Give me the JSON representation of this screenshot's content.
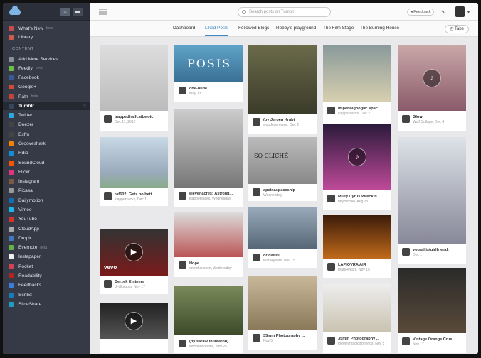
{
  "sidebar": {
    "top_buttons": [
      "home-icon",
      "film-icon"
    ],
    "pinned": [
      {
        "label": "What's New",
        "beta": "beta",
        "color": "#c94c4c"
      },
      {
        "label": "Library",
        "beta": "",
        "color": "#d15a4a"
      }
    ],
    "section_label": "CONTENT",
    "items": [
      {
        "label": "Add More Services",
        "beta": "",
        "color": "#8a8f99"
      },
      {
        "label": "Feedly",
        "beta": "beta",
        "color": "#6cc04a"
      },
      {
        "label": "Facebook",
        "beta": "",
        "color": "#3b5998"
      },
      {
        "label": "Google+",
        "beta": "",
        "color": "#d34836"
      },
      {
        "label": "Path",
        "beta": "beta",
        "color": "#c2453a"
      },
      {
        "label": "Tumblr",
        "beta": "",
        "color": "#35465c",
        "selected": true
      },
      {
        "label": "Twitter",
        "beta": "",
        "color": "#29a9e1"
      },
      {
        "label": "Deezer",
        "beta": "",
        "color": "#444"
      },
      {
        "label": "Exfm",
        "beta": "",
        "color": "#444"
      },
      {
        "label": "Grooveshark",
        "beta": "",
        "color": "#f77f00"
      },
      {
        "label": "Rdio",
        "beta": "",
        "color": "#0f8fd7"
      },
      {
        "label": "SoundCloud",
        "beta": "",
        "color": "#ff5500"
      },
      {
        "label": "Flickr",
        "beta": "",
        "color": "#e2337d"
      },
      {
        "label": "Instagram",
        "beta": "",
        "color": "#7a5a44"
      },
      {
        "label": "Picasa",
        "beta": "",
        "color": "#999"
      },
      {
        "label": "Dailymotion",
        "beta": "",
        "color": "#0e6fb5"
      },
      {
        "label": "Vimeo",
        "beta": "",
        "color": "#1ab7ea"
      },
      {
        "label": "YouTube",
        "beta": "",
        "color": "#d9322c"
      },
      {
        "label": "CloudApp",
        "beta": "",
        "color": "#aaa"
      },
      {
        "label": "Droplr",
        "beta": "",
        "color": "#3e78c1"
      },
      {
        "label": "Evernote",
        "beta": "beta",
        "color": "#61b248"
      },
      {
        "label": "Instapaper",
        "beta": "",
        "color": "#eee"
      },
      {
        "label": "Pocket",
        "beta": "",
        "color": "#d54055"
      },
      {
        "label": "Readability",
        "beta": "",
        "color": "#b3231f"
      },
      {
        "label": "Feedbacks",
        "beta": "",
        "color": "#3b7dd8"
      },
      {
        "label": "Scribd",
        "beta": "",
        "color": "#1a7bba"
      },
      {
        "label": "SlideShare",
        "beta": "",
        "color": "#1c9ec4"
      }
    ]
  },
  "topbar": {
    "search_placeholder": "Search posts on Tumblr",
    "feedback_label": "Feedback"
  },
  "tabs": [
    "Dashboard",
    "Liked Posts",
    "Followed Blogs",
    "Robby's playground",
    "The Film Stage",
    "The Burning House"
  ],
  "active_tab": 1,
  "tabs_button": "Tabs",
  "posts": [
    {
      "title": "trappedhalfcatbwoic",
      "sub": "Dec 11, 2012",
      "bg": "linear-gradient(#ddd,#bbb)"
    },
    {
      "title": "raf602: Gets no bett...",
      "sub": "klappersacks, Dec 1",
      "bg": "linear-gradient(#c9d8e5,#9ab 70%,#8a8)"
    },
    {
      "title": "Berzek Eminem",
      "sub": "dj-tillomoto, Nov 17",
      "bg": "linear-gradient(#333,#7a1a1a)"
    },
    {
      "title": "",
      "sub": "",
      "bg": "linear-gradient(#222,#555)"
    },
    {
      "title": "one-nude",
      "sub": "May 13",
      "bg": "linear-gradient(#5fa3c8,#3a6f94)"
    },
    {
      "title": "elevenacres: Astrojet...",
      "sub": "klappersacks, Wednesday",
      "bg": "linear-gradient(#ccc,#777)"
    },
    {
      "title": "Hope",
      "sub": "onnickarlsson, Wednesday",
      "bg": "linear-gradient(#ddd,#b55)"
    },
    {
      "title": "(by sarawuh Intarob)",
      "sub": "woodendreams, Nov 25",
      "bg": "linear-gradient(#7a8a5a,#3c4a2a)"
    },
    {
      "title": "(by Jeroen Krabi",
      "sub": "woodendreams, Dec 2",
      "bg": "linear-gradient(#6a6a4a,#3b3b2a)"
    },
    {
      "title": "apeinaspaceship",
      "sub": "Wednesday",
      "bg": "linear-gradient(#bbb,#888)"
    },
    {
      "title": "orlowski",
      "sub": "tears4years, Nov 15",
      "bg": "linear-gradient(#9ab,#567)"
    },
    {
      "title": "35mm Photography ...",
      "sub": "Nov 5",
      "bg": "linear-gradient(#c9b89a,#8a7a5a)"
    },
    {
      "title": "imperialgoogle: spac...",
      "sub": "klappersacks, Dec 2",
      "bg": "linear-gradient(#8a9a9a,#d8d0b0)"
    },
    {
      "title": "Miley Cyrus Wreckin...",
      "sub": "bnymitchel, Aug 25",
      "bg": "linear-gradient(#2a1a3a,#c04a9a)"
    },
    {
      "title": "LAPIOVRA AIR",
      "sub": "tears4years, Nov 15",
      "bg": "linear-gradient(#3a1a0a,#c06a1a)"
    },
    {
      "title": "35mm Photography ...",
      "sub": "theonlymagicistfriends, Nov 5",
      "bg": "linear-gradient(#eee,#c9c2b0)"
    },
    {
      "title": "Glow",
      "sub": "Wolf Collage, Dec 4",
      "bg": "linear-gradient(#c9a7a7,#8a5a6a)"
    },
    {
      "title": "youraliistgirlfriend,",
      "sub": "Dec 1",
      "bg": "linear-gradient(#dde3e8,#889)"
    },
    {
      "title": "Vintage Orange Crus...",
      "sub": "Nov 17",
      "bg": "linear-gradient(#2a2a2a,#5a4a3a)"
    }
  ],
  "overlay_texts": {
    "vevo": "vevo",
    "wall": "SO CLICHÉ",
    "poster": "POSIS"
  }
}
